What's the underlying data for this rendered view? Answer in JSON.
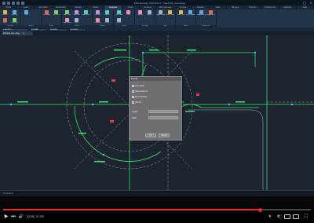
{
  "window": {
    "title": "Microsurvey CAD 2017 - [Sample_Ans.dwg]",
    "controls": [
      "–",
      "□",
      "×"
    ]
  },
  "tabs": [
    {
      "label": "Home"
    },
    {
      "label": "Insert"
    },
    {
      "label": "Annotate"
    },
    {
      "label": "Parametric"
    },
    {
      "label": "Survey"
    },
    {
      "label": "Points"
    },
    {
      "label": "Analysis"
    },
    {
      "label": "COGO"
    },
    {
      "label": "Surface"
    },
    {
      "label": "MicroSurvey"
    },
    {
      "label": "Curves"
    },
    {
      "label": "Output"
    },
    {
      "label": "View"
    },
    {
      "label": "Manage"
    },
    {
      "label": "Express"
    },
    {
      "label": "FieldGenius"
    },
    {
      "label": "Settings"
    },
    {
      "label": "Help"
    }
  ],
  "active_tab_index": 6,
  "ribbon": {
    "groups": [
      {
        "label": "Calculate",
        "buttons": [
          "Inverse",
          "Bearing",
          "Area",
          "Perimeter"
        ]
      },
      {
        "label": "Import",
        "buttons": [
          "Find"
        ]
      },
      {
        "label": "Angle",
        "buttons": [
          "Calc Angle",
          "Sun Shot"
        ]
      },
      {
        "label": "Labels",
        "buttons": [
          "Label Line",
          "Label Arc",
          "Label Area",
          "Label Point",
          "Table"
        ]
      },
      {
        "label": "Adjust",
        "buttons": [
          "Traverse",
          "Closure",
          "Compass",
          "Transit"
        ]
      },
      {
        "label": "Check",
        "buttons": [
          "Check Plot",
          "Verify",
          "Report"
        ]
      },
      {
        "label": "Settings",
        "buttons": [
          "Options",
          "Layers"
        ]
      },
      {
        "label": "Legal",
        "buttons": [
          "Legal Description",
          "Create Lots"
        ]
      },
      {
        "label": "Parcel",
        "buttons": [
          "Parcel Tool",
          "Parcel Report"
        ]
      },
      {
        "label": "Diagnostic",
        "buttons": [
          "Diagnostic Report",
          "Diagnostic Window"
        ]
      }
    ]
  },
  "layerbar": {
    "layer": "0 BYLAYER",
    "linetype": "BYLAYER",
    "lineweight": "BYLAYER",
    "color": "BYLAYER"
  },
  "file_tab": {
    "label": "Sample_Ans.dwg",
    "close": "×"
  },
  "dialog": {
    "title": "Inverse",
    "options": [
      "Auto Label",
      "Show Distance",
      "Show Bearing",
      "Use Arc"
    ],
    "fields": [
      "Length",
      "Delta"
    ],
    "ok_label": "OK",
    "cancel_label": "Cancel"
  },
  "command_line": {
    "prompt": "Command:"
  },
  "player": {
    "time": "22:38 / 27:08",
    "progress": 0.834
  },
  "colors": {
    "canvas": "#1e2430",
    "drawing_lines": "#2ee36a",
    "dashed": "#9aa2ac",
    "highlight": "#e23d3d",
    "accent": "#e52d27"
  }
}
